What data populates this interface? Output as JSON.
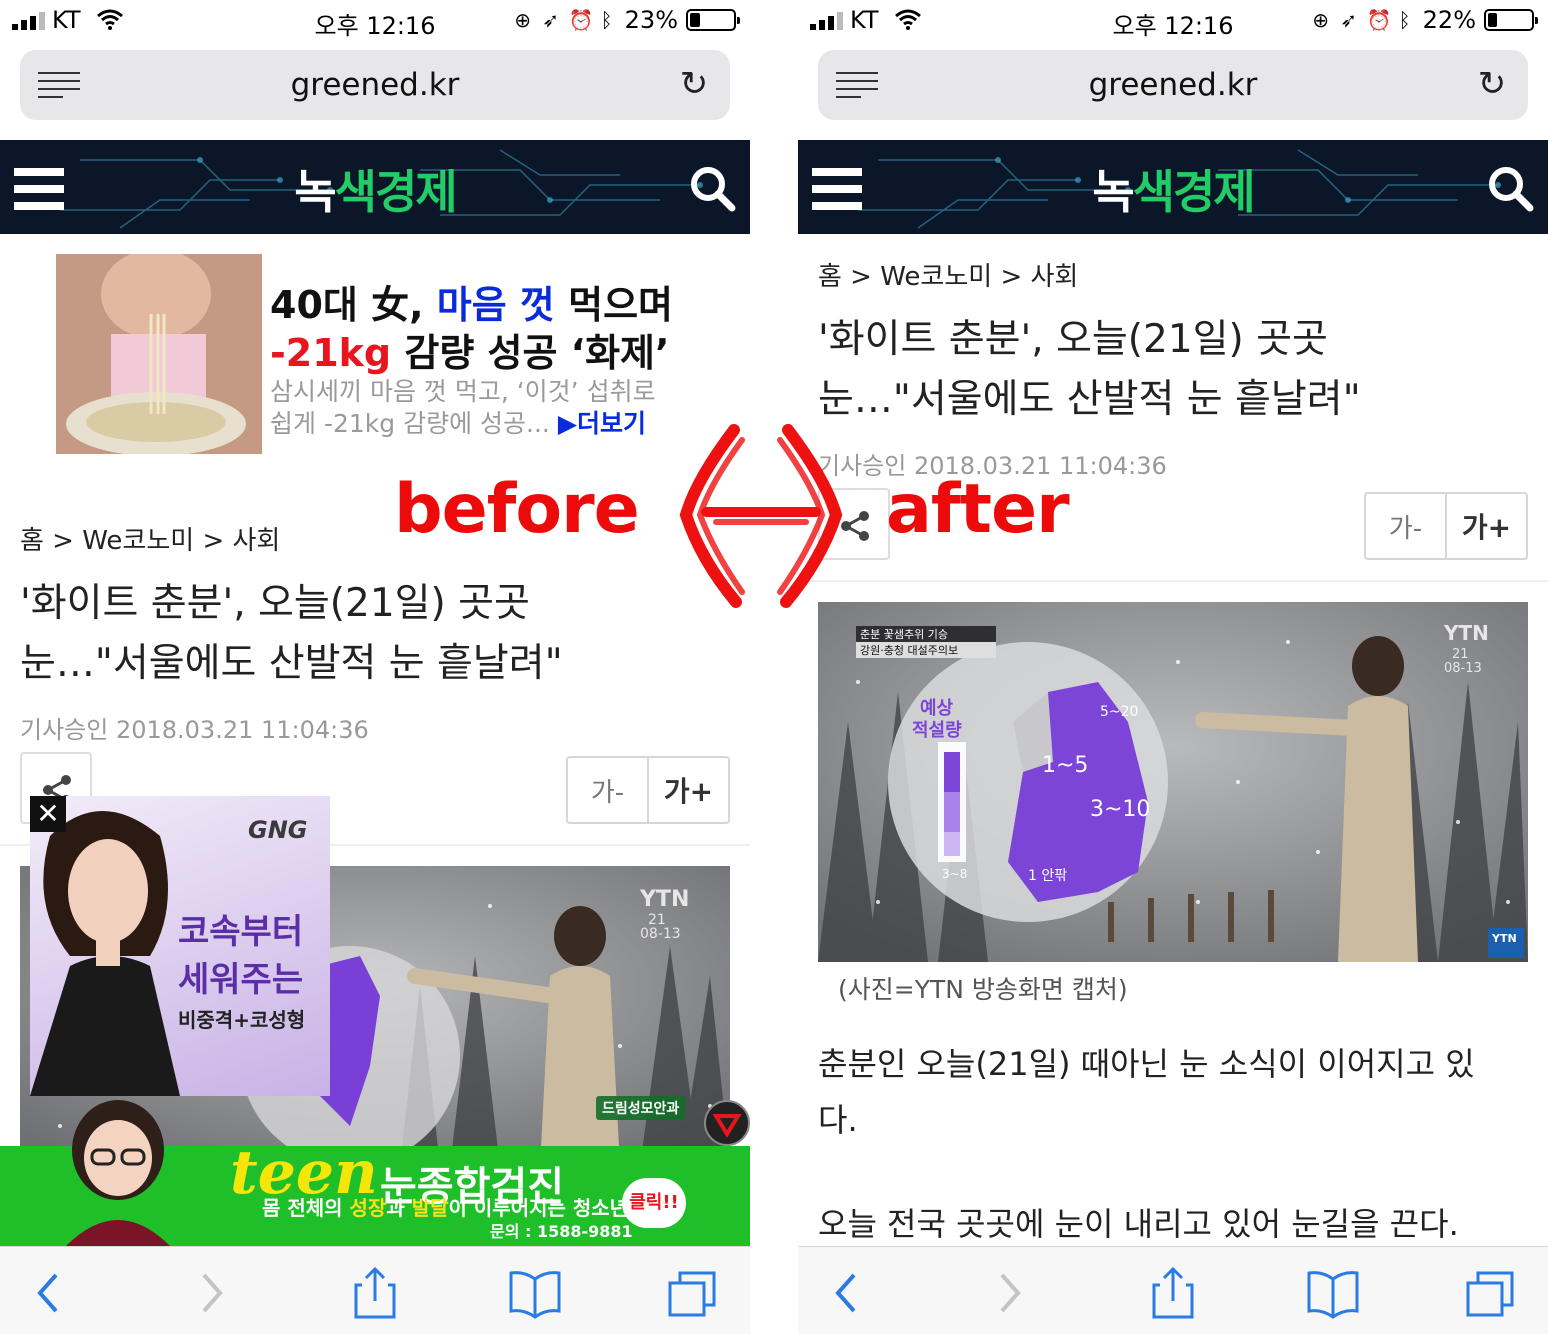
{
  "left": {
    "status": {
      "carrier": "KT",
      "time": "오후 12:16",
      "battery": "23%",
      "battery_level": 0.23
    },
    "browser": {
      "domain": "greened.kr"
    },
    "site": {
      "logo_a": "녹",
      "logo_b": "색",
      "logo_c": "경제"
    },
    "ad_top": {
      "line1_a": "40대 女, ",
      "line1_b": "마음 껏",
      "line1_c": " 먹으며",
      "line2_a": "-21kg",
      "line2_b": " 감량 성공 ‘화제’",
      "line3": "삼시세끼 마음 껏 먹고, ‘이것’ 섭취로",
      "line4_a": "쉽게 -21kg 감량에 성공... ",
      "line4_b": "▶더보기"
    },
    "article": {
      "breadcrumb": "홈 > We코노미 > 사회",
      "headline_1": "'화이트 춘분', 오늘(21일) 곳곳",
      "headline_2": "눈…\"서울에도 산발적 눈 흩날려\"",
      "approved": "기사승인 2018.03.21   11:04:36",
      "font_minus": "가-",
      "font_plus": "가+"
    },
    "float_ad": {
      "close": "✕",
      "brand": "GNG",
      "t1": "코속부터",
      "t2": "세워주는",
      "t3": "비중격+코성형"
    },
    "photo_overlay": {
      "logo": "YTN",
      "stamp1": "21",
      "stamp2": "08-13"
    },
    "dream_ad": "드림성모안과",
    "green_banner": {
      "teen": "teen",
      "title": "눈종합검진",
      "sub_a": "몸 전체의 ",
      "sub_b": "성장",
      "sub_c": "과 ",
      "sub_d": "발달",
      "sub_e": "이 이루어지는 청소년",
      "phone": "문의 : 1588-9881",
      "click": "클릭!!"
    }
  },
  "right": {
    "status": {
      "carrier": "KT",
      "time": "오후 12:16",
      "battery": "22%",
      "battery_level": 0.22
    },
    "browser": {
      "domain": "greened.kr"
    },
    "site": {
      "logo_a": "녹",
      "logo_b": "색",
      "logo_c": "경제"
    },
    "article": {
      "breadcrumb": "홈 > We코노미 > 사회",
      "headline_1": "'화이트 춘분', 오늘(21일) 곳곳",
      "headline_2": "눈…\"서울에도 산발적 눈 흩날려\"",
      "approved": "기사승인 2018.03.21   11:04:36",
      "font_minus": "가-",
      "font_plus": "가+",
      "caption": "(사진=YTN 방송화면 캡처)",
      "body_1": "춘분인 오늘(21일) 때아닌 눈 소식이 이어지고 있",
      "body_2": "다.",
      "body_3": "오늘 전국 곳곳에 눈이 내리고 있어 눈길을 끈다."
    },
    "photo_overlay": {
      "logo": "YTN",
      "stamp1": "21",
      "stamp2": "08-13",
      "tag1": "춘분 꽃샘추위 기승",
      "tag2": "강원·충청 대설주의보",
      "legend1": "예상",
      "legend2": "적설량",
      "r1": "5~20",
      "r2": "1~5",
      "r3": "3~10",
      "r4": "1 안팎",
      "r5": "3~8",
      "news_logo": "YTN"
    }
  },
  "annotations": {
    "before": "before",
    "after": "after"
  }
}
